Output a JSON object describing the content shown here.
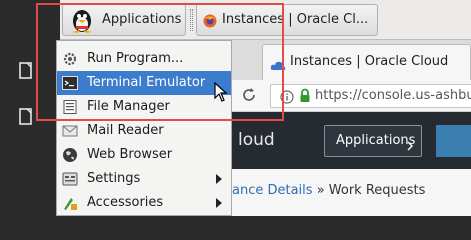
{
  "panel": {
    "applications_label": "Applications",
    "task_label": "Instances | Oracle Cl..."
  },
  "menu": {
    "items": [
      {
        "label": "Run Program...",
        "icon": "gear-icon"
      },
      {
        "label": "Terminal Emulator",
        "icon": "terminal-icon"
      },
      {
        "label": "File Manager",
        "icon": "file-manager-icon"
      },
      {
        "label": "Mail Reader",
        "icon": "mail-icon"
      },
      {
        "label": "Web Browser",
        "icon": "globe-icon"
      },
      {
        "label": "Settings",
        "icon": "settings-icon"
      },
      {
        "label": "Accessories",
        "icon": "accessories-icon"
      }
    ]
  },
  "browser": {
    "tab_title": "Instances | Oracle Cloud",
    "url": "https://console.us-ashburn",
    "brand": "loud",
    "applications_button": "Applications",
    "breadcrumb_link": "ance Details",
    "breadcrumb_sep": " » ",
    "breadcrumb_current": "Work Requests"
  },
  "colors": {
    "selection": "#3c7ccc",
    "highlight": "#e34a4a",
    "oci_header": "#252b31"
  }
}
